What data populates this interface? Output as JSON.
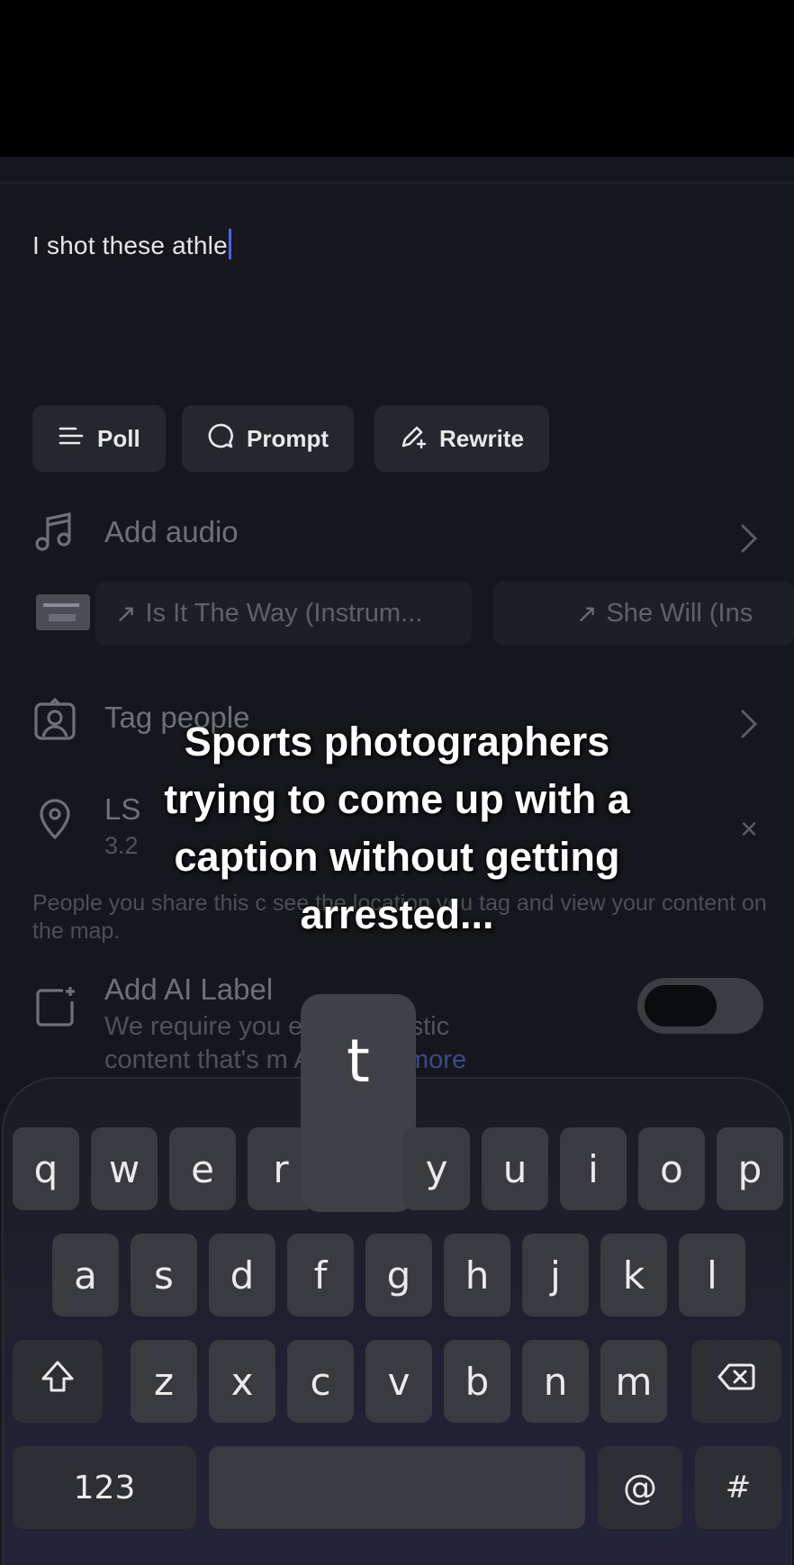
{
  "caption": {
    "text": "I shot these athle"
  },
  "chips": [
    {
      "label": "Poll",
      "icon": "list-icon"
    },
    {
      "label": "Prompt",
      "icon": "speech-bubble-icon"
    },
    {
      "label": "Rewrite",
      "icon": "pencil-sparkle-icon"
    }
  ],
  "audio": {
    "label": "Add audio",
    "suggestions": [
      {
        "title": "Is It The Way (Instrum..."
      },
      {
        "title": "She Will (Ins"
      }
    ]
  },
  "tag_people": {
    "label": "Tag people"
  },
  "location": {
    "name": "LS",
    "subtitle": "3.2",
    "helper": "People you share this c                    see the location you tag and view your content on the map."
  },
  "ai_label": {
    "title": "Add AI Label",
    "desc_line1": "We require you               ertain realistic",
    "desc_line2": "content that's m           AI. ",
    "link": "Learn more",
    "toggle_on": false
  },
  "overlay": {
    "lines": [
      "Sports photographers",
      "trying to come up with a",
      "caption without getting",
      "arrested..."
    ]
  },
  "keyboard": {
    "popup_key": "t",
    "row1": [
      "q",
      "w",
      "e",
      "r",
      "",
      "y",
      "u",
      "i",
      "o",
      "p"
    ],
    "row2": [
      "a",
      "s",
      "d",
      "f",
      "g",
      "h",
      "j",
      "k",
      "l"
    ],
    "row3": [
      "z",
      "x",
      "c",
      "v",
      "b",
      "n",
      "m"
    ],
    "numbers_key": "123",
    "at_key": "@",
    "hash_key": "#"
  },
  "colors": {
    "accent": "#4d63ff",
    "background": "#15171c",
    "chip": "#24272e"
  }
}
